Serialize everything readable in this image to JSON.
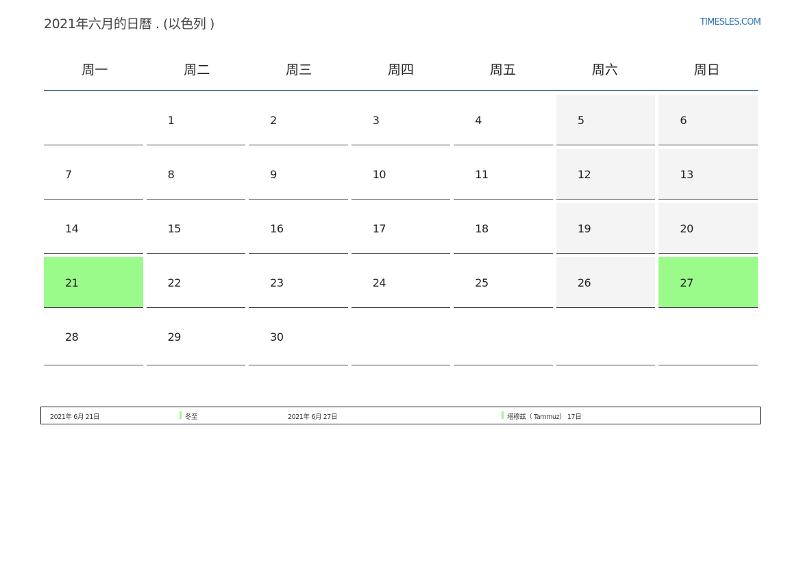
{
  "header": {
    "title": "2021年六月的日曆 . (以色列 )",
    "brand": "TIMESLES.COM"
  },
  "weekdays": [
    "周一",
    "周二",
    "周三",
    "周四",
    "周五",
    "周六",
    "周日"
  ],
  "weeks": [
    [
      "",
      "1",
      "2",
      "3",
      "4",
      "5",
      "6"
    ],
    [
      "7",
      "8",
      "9",
      "10",
      "11",
      "12",
      "13"
    ],
    [
      "14",
      "15",
      "16",
      "17",
      "18",
      "19",
      "20"
    ],
    [
      "21",
      "22",
      "23",
      "24",
      "25",
      "26",
      "27"
    ],
    [
      "28",
      "29",
      "30",
      "",
      "",
      "",
      ""
    ]
  ],
  "holidays": [
    {
      "date": "2021年 6月 21日",
      "name": "冬至"
    },
    {
      "date": "2021年 6月 27日",
      "name": "塔穆兹（ Tammuz） 17日"
    }
  ],
  "colors": {
    "holiday": "#9afa8a",
    "weekend": "#f4f4f4",
    "header_rule": "#5b7899",
    "brand": "#2f6fb3"
  }
}
